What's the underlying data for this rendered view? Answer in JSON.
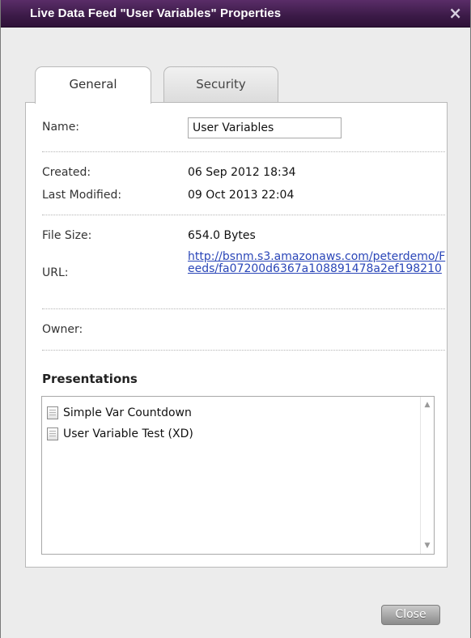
{
  "dialog": {
    "title": "Live Data Feed \"User Variables\" Properties",
    "close_glyph": "×"
  },
  "tabs": [
    {
      "label": "General",
      "active": true
    },
    {
      "label": "Security",
      "active": false
    }
  ],
  "general": {
    "name_label": "Name:",
    "name_value": "User Variables",
    "created_label": "Created:",
    "created_value": "06 Sep 2012 18:34",
    "modified_label": "Last Modified:",
    "modified_value": "09 Oct 2013 22:04",
    "filesize_label": "File Size:",
    "filesize_value": "654.0 Bytes",
    "url_label": "URL:",
    "url_value": "http://bsnm.s3.amazonaws.com/peterdemo/Feeds/fa07200d6367a108891478a2ef198210",
    "owner_label": "Owner:",
    "owner_value": ""
  },
  "presentations": {
    "heading": "Presentations",
    "items": [
      {
        "label": "Simple Var Countdown",
        "icon": "document-icon"
      },
      {
        "label": "User Variable Test (XD)",
        "icon": "document-icon"
      }
    ]
  },
  "footer": {
    "close_label": "Close"
  },
  "colors": {
    "titlebar": "#3b1a47",
    "link": "#2a46b8",
    "panel": "#ffffff",
    "dialog_bg": "#ececec"
  }
}
